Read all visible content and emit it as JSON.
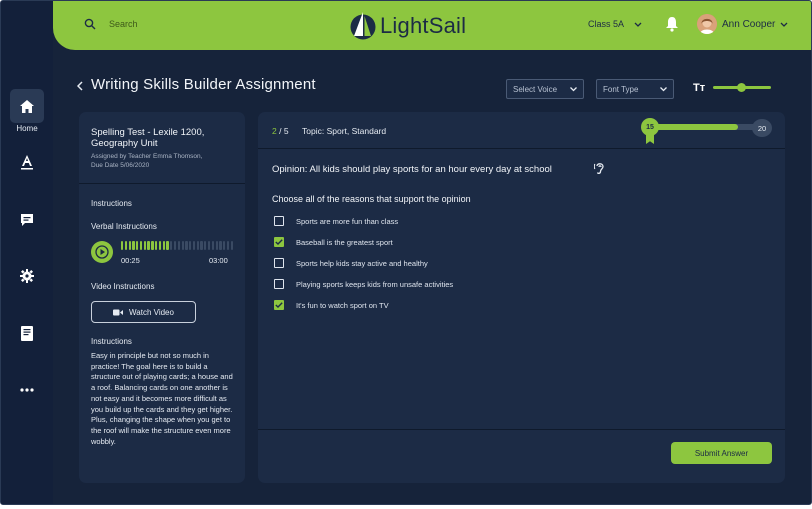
{
  "topbar": {
    "search_placeholder": "Search",
    "brand": "LightSail",
    "class_selected": "Class 5A",
    "user_name": "Ann Cooper"
  },
  "sidebar": {
    "items": [
      {
        "label": "Home",
        "icon": "home-icon",
        "active": true
      },
      {
        "label": "",
        "icon": "font-icon"
      },
      {
        "label": "",
        "icon": "chat-icon"
      },
      {
        "label": "",
        "icon": "gear-icon"
      },
      {
        "label": "",
        "icon": "book-icon"
      },
      {
        "label": "",
        "icon": "more-icon"
      }
    ]
  },
  "header": {
    "title": "Writing Skills Builder Assignment",
    "voice_select": "Select Voice",
    "font_select": "Font Type",
    "text_size_label": "Tт",
    "text_size_level": 0.45
  },
  "assignment": {
    "title": "Spelling Test - Lexile 1200, Geography Unit",
    "assigned_by": "Assigned by Teacher Emma Thomson,",
    "due_date": "Due Date 5/06/2020",
    "instructions_label": "Instructions",
    "verbal_label": "Verbal Instructions",
    "audio_elapsed": "00:25",
    "audio_total": "03:00",
    "audio_progress": 0.44,
    "video_label": "Video Instructions",
    "watch_label": "Watch Video",
    "instructions_heading": "Instructions",
    "instructions_body": "Easy in principle but not so much in practice! The goal here is to build a structure out of playing cards; a house and a roof. Balancing cards on one another is not easy and it becomes more difficult as you build up the cards and they get higher. Plus, changing the shape when you get to the roof will make the structure even more wobbly."
  },
  "question": {
    "current": "2",
    "total": "/ 5",
    "topic": "Topic: Sport, Standard",
    "progress_current": "15",
    "progress_max": "20",
    "progress_fraction": 0.75,
    "opinion": "Opinion: All kids should play sports for an hour every day at school",
    "prompt": "Choose all of the reasons that support the opinion",
    "options": [
      {
        "text": "Sports are more fun than class",
        "checked": false
      },
      {
        "text": "Baseball is the greatest sport",
        "checked": true
      },
      {
        "text": "Sports help kids stay active and healthy",
        "checked": false
      },
      {
        "text": "Playing sports keeps kids from unsafe activities",
        "checked": false
      },
      {
        "text": "It's fun to watch sport on TV",
        "checked": true
      }
    ],
    "submit_label": "Submit Answer"
  },
  "colors": {
    "accent": "#8dc63f",
    "panel": "#1c2b45",
    "background": "#16233a"
  }
}
